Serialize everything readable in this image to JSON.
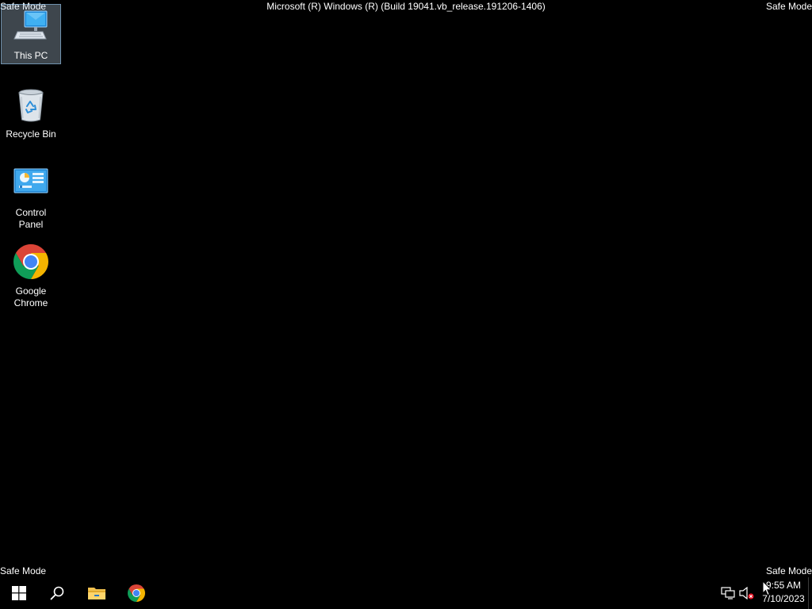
{
  "watermarks": {
    "top_left": "Safe Mode",
    "top_right": "Safe Mode",
    "bottom_left": "Safe Mode",
    "bottom_right": "Safe Mode",
    "build_string": "Microsoft (R) Windows (R) (Build 19041.vb_release.191206-1406)"
  },
  "desktop_icons": [
    {
      "label": "This PC",
      "icon": "this-pc-icon",
      "selected": true
    },
    {
      "label": "Recycle Bin",
      "icon": "recycle-bin-icon",
      "selected": false
    },
    {
      "label": "Control Panel",
      "icon": "control-panel-icon",
      "selected": false
    },
    {
      "label": "Google Chrome",
      "icon": "chrome-icon",
      "selected": false
    }
  ],
  "taskbar": {
    "pinned": [
      {
        "icon": "windows-start-icon"
      },
      {
        "icon": "search-icon"
      },
      {
        "icon": "file-explorer-icon"
      },
      {
        "icon": "chrome-icon"
      }
    ],
    "tray": [
      {
        "icon": "network-icon"
      },
      {
        "icon": "volume-muted-icon"
      }
    ],
    "clock": {
      "time": "9:55 AM",
      "date": "7/10/2023"
    }
  },
  "colors": {
    "desktop_background": "#000000",
    "text": "#ffffff",
    "selection": "#cce8ff"
  }
}
